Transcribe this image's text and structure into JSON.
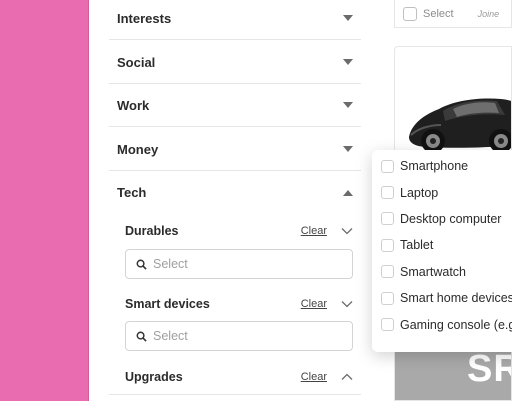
{
  "sections": [
    {
      "label": "Interests",
      "state": "collapsed"
    },
    {
      "label": "Social",
      "state": "collapsed"
    },
    {
      "label": "Work",
      "state": "collapsed"
    },
    {
      "label": "Money",
      "state": "collapsed"
    },
    {
      "label": "Tech",
      "state": "expanded"
    }
  ],
  "tech": {
    "subsections": [
      {
        "label": "Durables",
        "clear_label": "Clear",
        "chevron": "down",
        "placeholder": "Select"
      },
      {
        "label": "Smart devices",
        "clear_label": "Clear",
        "chevron": "down",
        "placeholder": "Select"
      },
      {
        "label": "Upgrades",
        "clear_label": "Clear",
        "chevron": "up"
      }
    ]
  },
  "dropdown": {
    "options": [
      "Smartphone",
      "Laptop",
      "Desktop computer",
      "Tablet",
      "Smartwatch",
      "Smart home devices",
      "Gaming console (e.g"
    ]
  },
  "right_card": {
    "select_label": "Select",
    "joined_label": "Joine"
  },
  "promo": {
    "text": "SR"
  },
  "colors": {
    "sidebar_pink": "#e96bb0",
    "promo_gray": "#a9a9a9",
    "border": "#e6e6e6"
  },
  "icons": {
    "collapsed": "caret-down-icon",
    "expanded": "caret-up-icon",
    "search": "search-icon"
  }
}
